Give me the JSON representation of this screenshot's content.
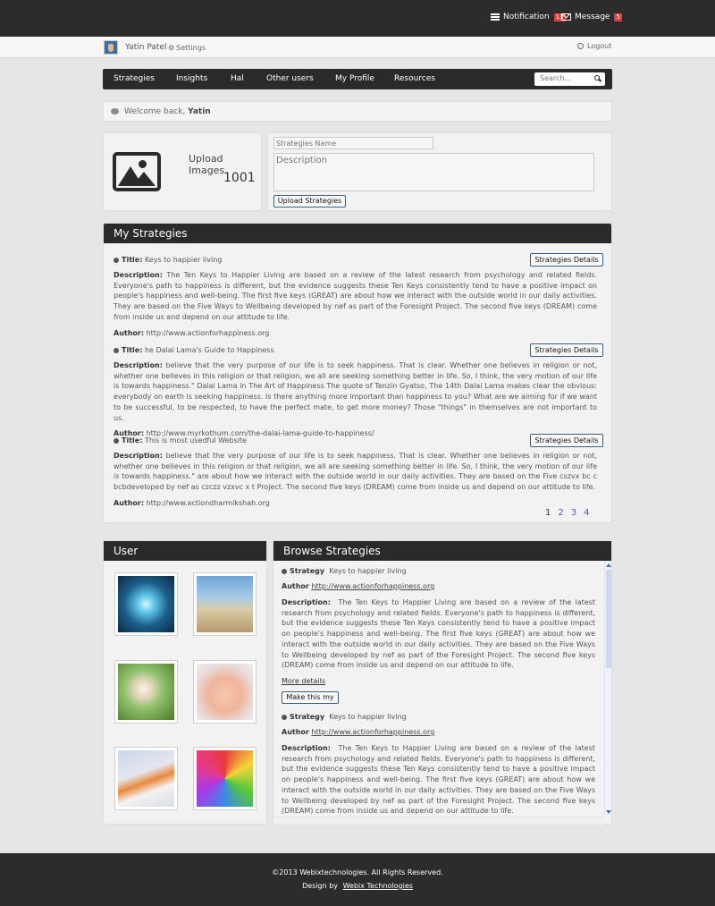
{
  "topbar": {
    "notification_label": "Notification",
    "notification_count": "13",
    "message_label": "Message",
    "message_count": "5"
  },
  "userbar": {
    "user_name": "Yatin Patel",
    "settings_label": "Settings",
    "logout_label": "Logout"
  },
  "nav": {
    "items": [
      "Strategies",
      "Insights",
      "Hal",
      "Other users",
      "My Profile",
      "Resources"
    ],
    "search_placeholder": "Search..."
  },
  "welcome": {
    "prefix": "Welcome back,",
    "name": "Yatin"
  },
  "upload": {
    "label": "Upload Images",
    "count": "1001"
  },
  "strategy_form": {
    "name_placeholder": "Strategies Name",
    "description_placeholder": "Description",
    "submit_label": "Upload Strategies"
  },
  "my_strategies": {
    "heading": "My Strategies",
    "title_label": "Title:",
    "description_label": "Description:",
    "author_label": "Author:",
    "details_button": "Strategies Details",
    "items": [
      {
        "title": "Keys to happier living",
        "description": "The Ten Keys to Happier Living are based on a review of the latest research from psychology and related fields. Everyone's path to happiness is different, but the evidence suggests these Ten Keys consistently tend to have a positive impact on people's happiness and well-being. The first five keys (GREAT) are about how we interact with the outside world in our daily activities. They are based on the Five Ways to Wellbeing developed by nef as part of the Foresight Project. The second five keys (DREAM) come from inside us and depend on our attitude to life.",
        "author": "http://www.actionforhappiness.org"
      },
      {
        "title": "he Dalai Lama's Guide to Happiness",
        "description": "believe that the very purpose of our life is to seek happiness. That is clear. Whether one believes in religion or not, whether one believes in this religion or that religion, we all are seeking something better in life. So, I think, the very motion of our life is towards happiness.\" Dalai Lama in The Art of Happiness The quote of Tenzin Gyatso, The 14th Dalai Lama makes clear the obvious: everybody on earth is seeking happiness. Is there anything more important than happiness to you? What are we aiming for if we want to be successful, to be respected, to have the perfect mate, to get more money? Those \"things\" in themselves are not important to us.",
        "author": "http://www.myrkothum.com/the-dalai-lama-guide-to-happiness/"
      },
      {
        "title": "This is most usedful Website",
        "description": "believe that the very purpose of our life is to seek happiness. That is clear. Whether one believes in religion or not, whether one believes in this religion or that religion, we all are seeking something better in life. So, I think, the very motion of our life is towards happiness.\" are about how we interact with the outside world in our daily activities. They are based on the Five cszvx bc c bcbdeveloped by nef as czczz vzxvc x t Project. The second five keys (DREAM) come from inside us and depend on our attitude to life.",
        "author": "http://www.actiondharmikshah.org"
      }
    ],
    "pages": [
      "1",
      "2",
      "3",
      "4"
    ]
  },
  "user_panel": {
    "heading": "User",
    "photos": [
      "globe-photo",
      "boat-photo",
      "girl-photo",
      "baby-photo",
      "tiger-photo",
      "flower-photo"
    ]
  },
  "browse": {
    "heading": "Browse Strategies",
    "strategy_label": "Strategy",
    "author_label": "Author",
    "description_label": "Description:",
    "more_label": "More details",
    "make_button": "Make this my",
    "items": [
      {
        "strategy": "Keys to happier living",
        "author": "http://www.actionforhappiness.org",
        "description": "The Ten Keys to Happier Living are based on a review of the latest research from psychology and related fields. Everyone's path to happiness is different, but the evidence suggests these Ten Keys consistently tend to have a positive impact on people's happiness and well-being. The first five keys (GREAT) are about how we interact with the outside world in our daily activities. They are based on the Five Ways to Wellbeing developed by nef as part of the Foresight Project. The second five keys (DREAM) come from inside us and depend on our attitude to life."
      },
      {
        "strategy": "Keys to happier living",
        "author": "http://www.actionforhappiness.org",
        "description": "The Ten Keys to Happier Living are based on a review of the latest research from psychology and related fields. Everyone's path to happiness is different, but the evidence suggests these Ten Keys consistently tend to have a positive impact on people's happiness and well-being. The first five keys (GREAT) are about how we interact with the outside world in our daily activities. They are based on the Five Ways to Wellbeing developed by nef as part of the Foresight Project. The second five keys (DREAM) come from inside us and depend on our attitude to life."
      }
    ]
  },
  "footer": {
    "copyright": "©2013 Webixtechnologies. All Rights Reserved.",
    "design_by": "Design by",
    "designer": "Webix Technologies"
  },
  "colors": {
    "dark_bar": "#2c2c2c",
    "badge_red": "#e03c3c",
    "page_bg": "#e6e6e6",
    "link_purple": "#6a4fa3"
  }
}
